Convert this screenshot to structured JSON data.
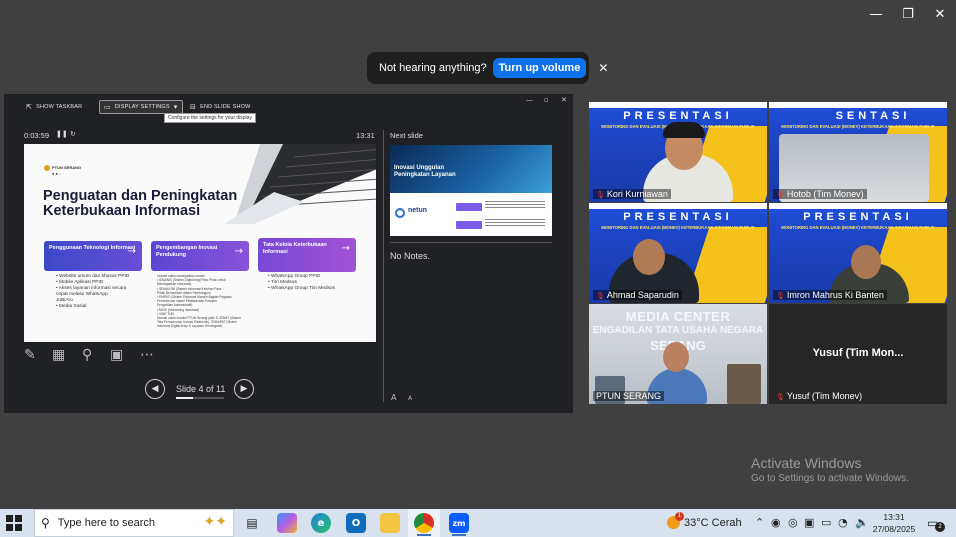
{
  "window_controls": {
    "minimize": "—",
    "restore": "❐",
    "close": "✕"
  },
  "notification": {
    "text": "Not hearing anything?",
    "button": "Turn up volume",
    "close": "✕"
  },
  "presenter": {
    "toolbar": {
      "show_taskbar": "SHOW TASKBAR",
      "display_settings": "DISPLAY SETTINGS",
      "end_slide_show": "END SLIDE SHOW",
      "tooltip": "Configure the settings for your display"
    },
    "elapsed_time": "0:03:59",
    "clock": "13:31",
    "slide": {
      "logo_text": "PTUN SERANG",
      "title": "Penguatan dan Peningkatan Keterbukaan Informasi",
      "cards": [
        {
          "title": "Penggunaan Teknologi Informasi",
          "arrow": "→"
        },
        {
          "title": "Pengembangan Inovasi Pendukung",
          "arrow": "→"
        },
        {
          "title": "Tata Kelola Keterbukaan Informasi",
          "arrow": "→"
        }
      ],
      "list1": [
        "• Website umum dan khusus PPID",
        "• Mobile Aplikasi PPID",
        "• Akses layanan informasi secara",
        "  cepat melalui WhatsApp",
        "  JoBiAro",
        "• Media Sosial"
      ],
      "list2": [
        "Inovasi untuk mewujudkan umum:",
        "• SIMANIS (Sistem Digital bagi Para Pihak untuk",
        "  Mendapatkan Informasi)",
        "• SEMUA INI (Sistem Informasi Keluhan Para",
        "  Pihak Bersamberi dalam Pembangun)",
        "• EMPATI (Sistem Elaborasi Mandiri Bagian Pegawai",
        "  Permohonan dalam Pelaksanaan Putusan",
        "  Pengadilan Administratif)",
        "• MOSI (Monitoring Informasi)",
        "• VINE TUN",
        "Inovasi untuk inovasi PTUN Serang yaitu E-JEMAT (Sistem",
        "Tata Permohonan Inovasi Elektronik), SOBAPAT (Sistem",
        "Informasi Digital Arsip & Layanan Terintegrasi)"
      ],
      "list3": [
        "• WhatsApp Group PPID",
        "• Tim Medsos",
        "• WhatsApp Group Tim Medsos"
      ]
    },
    "slide_counter": "Slide 4 of 11",
    "slide_progress": 0.36,
    "next_slide_label": "Next slide",
    "next_slide": {
      "title": "Inovasi Unggulan Peningkatan Layanan",
      "logo": "netun"
    },
    "notes": "No Notes."
  },
  "participants": [
    {
      "name": "Kori Kurniawan",
      "muted": true
    },
    {
      "name": "Hotob (Tim Monev)",
      "muted": true
    },
    {
      "name": "Ahmad Saparudin",
      "muted": true
    },
    {
      "name": "Imron Mahrus Ki Banten",
      "muted": true
    },
    {
      "name": "PTUN SERANG",
      "muted": false,
      "active": true
    },
    {
      "name": "Yusuf (Tim Monev)",
      "muted": true,
      "video_off_label": "Yusuf (Tim Mon..."
    }
  ],
  "banner": {
    "title": "PRESENTASI",
    "title_right": "SENTASI",
    "subtitle": "MONITORING DAN EVALUASI (MONEV) KETERBUKAAN INFORMASI PUBLIK"
  },
  "media_center": {
    "line1": "MEDIA CENTER",
    "line2": "ENGADILAN TATA USAHA NEGARA",
    "line3": "SERANG"
  },
  "activate_windows": {
    "title": "Activate Windows",
    "subtitle": "Go to Settings to activate Windows."
  },
  "taskbar": {
    "search_placeholder": "Type here to search",
    "weather": "33°C  Cerah",
    "weather_badge": "1",
    "time": "13:31",
    "date": "27/08/2025",
    "notification_count": "2"
  }
}
